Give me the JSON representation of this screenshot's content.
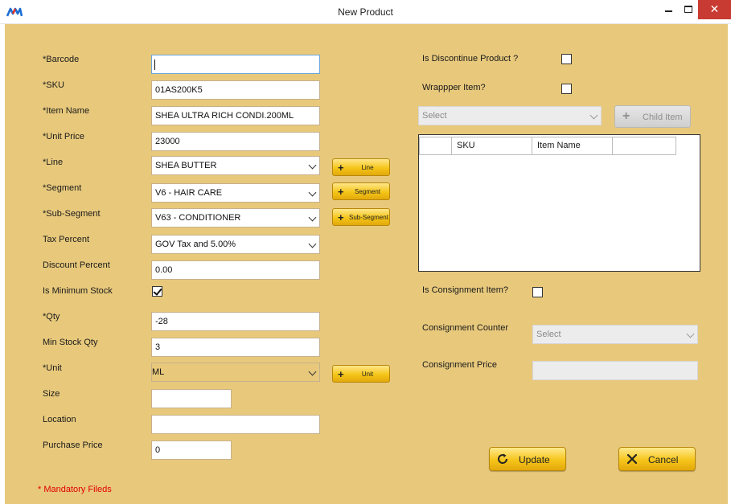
{
  "window": {
    "title": "New Product",
    "minimize": "—",
    "close": "✕"
  },
  "form": {
    "barcode": {
      "label": "Barcode",
      "value": ""
    },
    "sku": {
      "label": "SKU",
      "value": "01AS200K5"
    },
    "item_name": {
      "label": "Item Name",
      "value": "SHEA ULTRA RICH CONDI.200ML"
    },
    "unit_price": {
      "label": "Unit Price",
      "value": "23000"
    },
    "line": {
      "label": "Line",
      "value": "SHEA BUTTER"
    },
    "segment": {
      "label": "Segment",
      "value": "V6 - HAIR CARE"
    },
    "sub_segment": {
      "label": "Sub-Segment",
      "value": "V63 - CONDITIONER"
    },
    "tax_percent": {
      "label": "Tax Percent",
      "value": "GOV Tax and 5.00%"
    },
    "discount_percent": {
      "label": "Discount Percent",
      "value": "0.00"
    },
    "is_minimum_stock": {
      "label": "Is Minimum Stock",
      "checked": true
    },
    "qty": {
      "label": "Qty",
      "value": "-28"
    },
    "min_stock_qty": {
      "label": "Min Stock Qty",
      "value": "3"
    },
    "unit": {
      "label": "Unit",
      "value": "ML"
    },
    "size": {
      "label": "Size",
      "value": ""
    },
    "location": {
      "label": "Location",
      "value": ""
    },
    "purchase_price": {
      "label": "Purchase Price",
      "value": "0"
    },
    "required_marker": "*"
  },
  "add_buttons": {
    "line": "Line",
    "segment": "Segment",
    "sub_segment": "Sub-Segment",
    "unit": "Unit"
  },
  "right": {
    "is_discontinue": {
      "label": "Is Discontinue Product ?",
      "checked": false
    },
    "wrapper_item": {
      "label": "Wrappper Item?",
      "checked": false
    },
    "child_select": {
      "placeholder": "Select"
    },
    "child_item_button": "Child Item",
    "grid": {
      "columns": [
        "",
        "SKU",
        "Item Name",
        ""
      ]
    },
    "is_consignment": {
      "label": "Is Consignment Item?",
      "checked": false
    },
    "consignment_counter": {
      "label": "Consignment Counter",
      "placeholder": "Select"
    },
    "consignment_price": {
      "label": "Consignment Price",
      "value": ""
    }
  },
  "actions": {
    "update": "Update",
    "cancel": "Cancel"
  },
  "footer": {
    "mandatory_note": "* Mandatory Fileds"
  },
  "colors": {
    "panel_bg": "#e8c97c",
    "button_yellow": "#f5c518",
    "mandatory_red": "#e00000",
    "close_red": "#c83b32"
  },
  "icons": [
    "app-logo",
    "minimize-icon",
    "maximize-icon",
    "close-icon",
    "plus-icon",
    "chevron-down-icon",
    "refresh-icon",
    "x-icon",
    "checkmark-icon"
  ]
}
